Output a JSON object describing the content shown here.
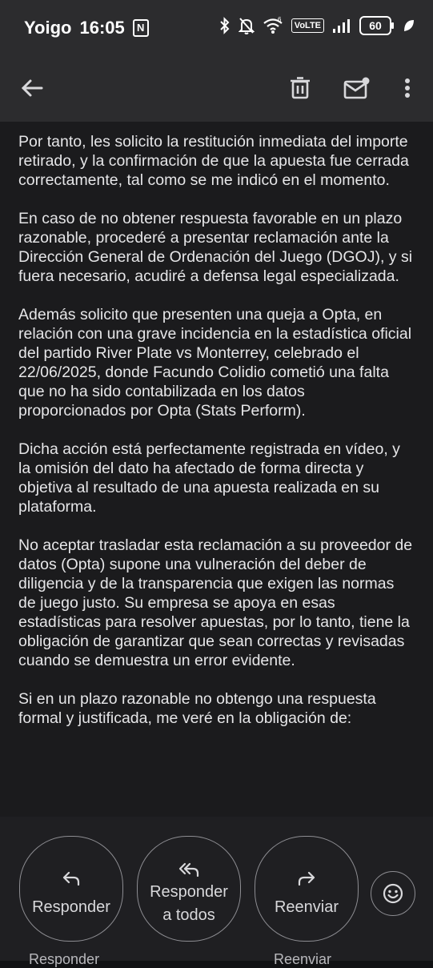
{
  "status_bar": {
    "carrier": "Yoigo",
    "time": "16:05",
    "nfc": "N",
    "network_badge": "VoLTE",
    "battery_level": "60"
  },
  "toolbar": {
    "icons": [
      "back-arrow-icon",
      "delete-icon",
      "mark-unread-icon",
      "more-vert-icon"
    ]
  },
  "email": {
    "paragraphs": [
      "Por tanto, les solicito la restitución inmediata del importe retirado, y la confirmación de que la apuesta fue cerrada correctamente, tal como se me indicó en el momento.",
      "En caso de no obtener respuesta favorable en un plazo razonable, procederé a presentar reclamación ante la Dirección General de Ordenación del Juego (DGOJ), y si fuera necesario, acudiré a defensa legal especializada.",
      "Además solicito que presenten una queja a Opta, en relación con una grave incidencia en la estadística oficial del partido River Plate vs Monterrey, celebrado el 22/06/2025, donde Facundo Colidio cometió una falta que no ha sido contabilizada en los datos proporcionados por Opta (Stats Perform).",
      "Dicha acción está perfectamente registrada en vídeo, y la omisión del dato ha afectado de forma directa y objetiva al resultado de una apuesta realizada en su plataforma.",
      "No aceptar trasladar esta reclamación a su proveedor de datos (Opta) supone una vulneración del deber de diligencia y de la transparencia que exigen las normas de juego justo. Su empresa se apoya en esas estadísticas para resolver apuestas, por lo tanto, tiene la obligación de garantizar que sean correctas y revisadas cuando se demuestra un error evidente.",
      "Si en un plazo razonable no obtengo una respuesta formal y justificada, me veré en la obligación de:"
    ]
  },
  "actions": {
    "reply": "Responder",
    "reply_all_line1": "Responder",
    "reply_all_line2": "a todos",
    "forward": "Reenviar",
    "emoji_icon": "add-reaction-icon"
  },
  "peek": {
    "left": "Responder",
    "right": "Reenviar"
  },
  "colors": {
    "bar_bg": "#2c2c2e",
    "content_bg": "#1b1b1d",
    "text": "#e6e6e8"
  }
}
